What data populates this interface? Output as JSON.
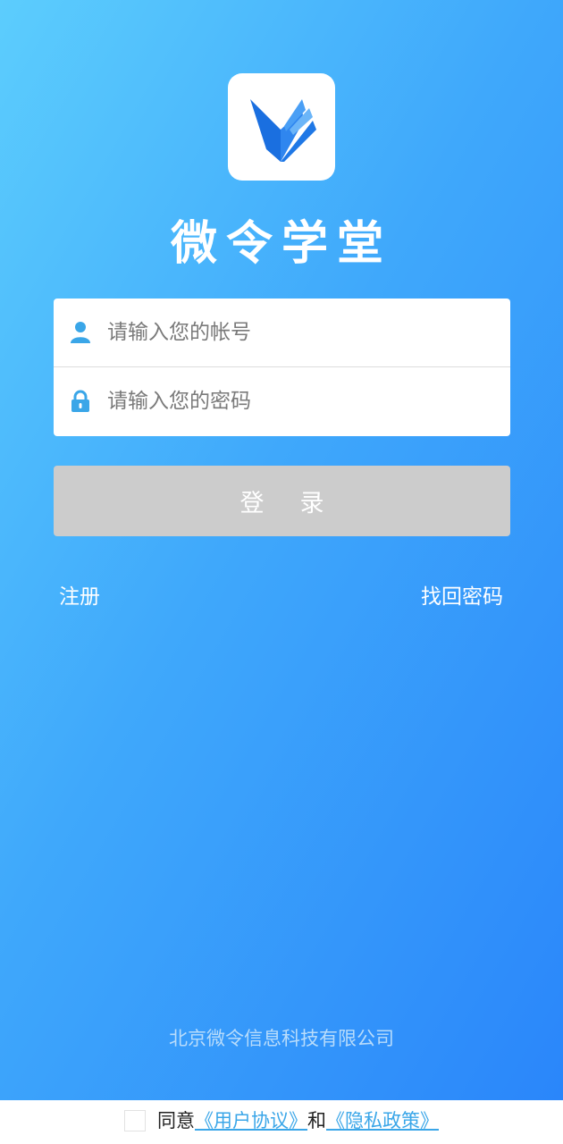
{
  "app": {
    "title": "微令学堂"
  },
  "login_form": {
    "account_placeholder": "请输入您的帐号",
    "password_placeholder": "请输入您的密码",
    "login_button": "登录"
  },
  "links": {
    "register": "注册",
    "forgot_password": "找回密码"
  },
  "footer": {
    "company": "北京微令信息科技有限公司",
    "agree_prefix": "同意",
    "user_agreement": "《用户协议》",
    "conjunction": "和",
    "privacy_policy": "《隐私政策》"
  },
  "icons": {
    "logo": "book-icon",
    "account": "user-icon",
    "password": "lock-icon"
  },
  "colors": {
    "gradient_start": "#5ccdfd",
    "gradient_end": "#2a86fa",
    "icon_blue": "#3aa6e8",
    "button_disabled": "#cccccc",
    "link": "#3aa6e8"
  }
}
